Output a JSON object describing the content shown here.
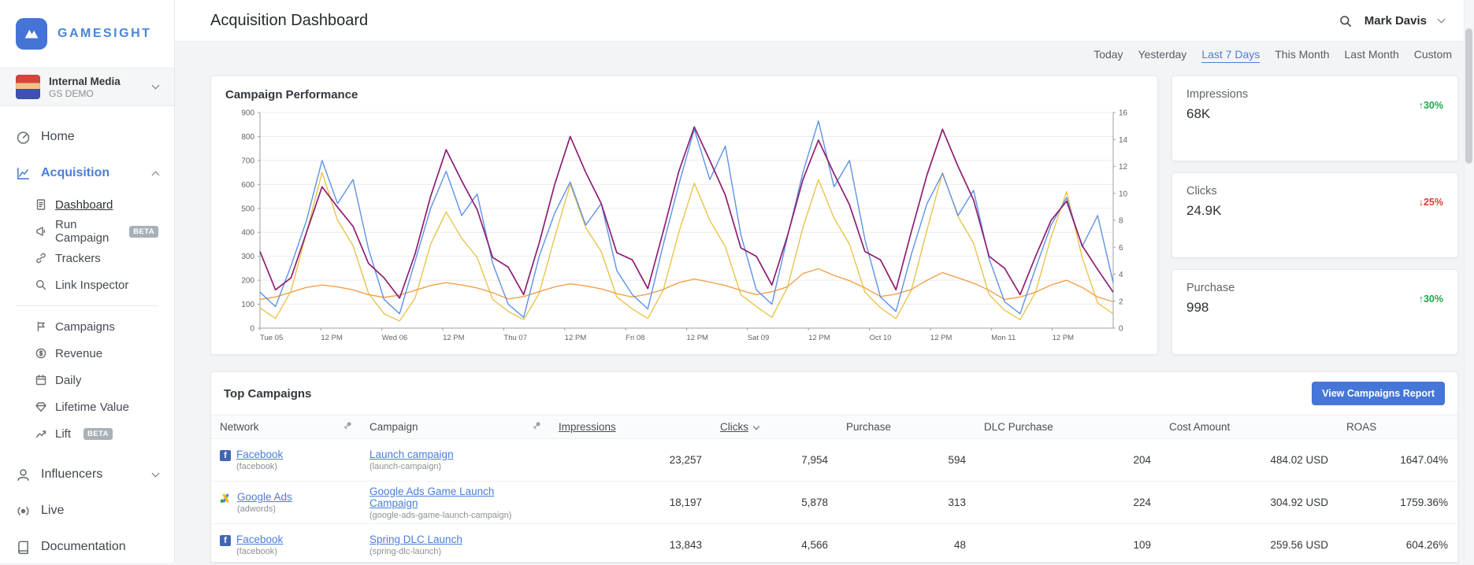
{
  "brand": {
    "name": "GAMESIGHT"
  },
  "account": {
    "name": "Internal Media",
    "org": "GS DEMO"
  },
  "header": {
    "title": "Acquisition Dashboard",
    "user": "Mark Davis"
  },
  "date_ranges": {
    "items": [
      "Today",
      "Yesterday",
      "Last 7 Days",
      "This Month",
      "Last Month",
      "Custom"
    ],
    "active": "Last 7 Days"
  },
  "sidebar": {
    "items": [
      {
        "label": "Home"
      },
      {
        "label": "Acquisition",
        "expanded": true,
        "children": [
          {
            "label": "Dashboard",
            "active": true
          },
          {
            "label": "Run Campaign",
            "badge": "BETA"
          },
          {
            "label": "Trackers"
          },
          {
            "label": "Link Inspector"
          },
          {
            "label": "Campaigns"
          },
          {
            "label": "Revenue"
          },
          {
            "label": "Daily"
          },
          {
            "label": "Lifetime Value"
          },
          {
            "label": "Lift",
            "badge": "BETA"
          }
        ]
      },
      {
        "label": "Influencers"
      },
      {
        "label": "Live"
      },
      {
        "label": "Documentation"
      }
    ]
  },
  "stats": [
    {
      "label": "Impressions",
      "value": "68K",
      "delta": "↑30%",
      "trend": "up"
    },
    {
      "label": "Clicks",
      "value": "24.9K",
      "delta": "↓25%",
      "trend": "down"
    },
    {
      "label": "Purchase",
      "value": "998",
      "delta": "↑30%",
      "trend": "up"
    }
  ],
  "chart_data": {
    "type": "line",
    "title": "Campaign Performance",
    "x_tick_labels": [
      "Tue 05",
      "12 PM",
      "Wed 06",
      "12 PM",
      "Thu 07",
      "12 PM",
      "Fri 08",
      "12 PM",
      "Sat 09",
      "12 PM",
      "Oct 10",
      "12 PM",
      "Mon 11",
      "12 PM"
    ],
    "y_left": {
      "min": 0,
      "max": 900,
      "step": 100
    },
    "y_right": {
      "min": 0,
      "max": 16,
      "step": 2
    },
    "grid": true,
    "legend": false,
    "series": [
      {
        "name": "series-1",
        "color": "#e8c44f",
        "values": [
          85,
          40,
          155,
          400,
          650,
          450,
          345,
          145,
          60,
          30,
          125,
          350,
          485,
          375,
          295,
          120,
          70,
          35,
          145,
          380,
          600,
          420,
          320,
          130,
          80,
          40,
          160,
          400,
          605,
          450,
          340,
          140,
          90,
          45,
          170,
          420,
          620,
          460,
          350,
          150,
          85,
          40,
          160,
          410,
          650,
          465,
          355,
          140,
          75,
          35,
          150,
          380,
          570,
          295,
          105,
          60
        ]
      },
      {
        "name": "series-2",
        "color": "#f4a04c",
        "values": [
          120,
          130,
          150,
          170,
          180,
          172,
          160,
          140,
          128,
          138,
          158,
          178,
          190,
          180,
          168,
          148,
          122,
          132,
          152,
          172,
          185,
          176,
          164,
          144,
          130,
          142,
          162,
          190,
          205,
          192,
          178,
          158,
          140,
          152,
          172,
          228,
          248,
          220,
          198,
          168,
          132,
          142,
          162,
          200,
          232,
          210,
          188,
          158,
          120,
          130,
          150,
          180,
          200,
          170,
          130,
          110
        ]
      },
      {
        "name": "series-3",
        "color": "#5e92e5",
        "values": [
          150,
          90,
          260,
          450,
          700,
          520,
          620,
          330,
          120,
          60,
          280,
          500,
          655,
          470,
          560,
          270,
          100,
          45,
          300,
          480,
          610,
          430,
          520,
          240,
          140,
          80,
          350,
          600,
          830,
          620,
          760,
          390,
          160,
          100,
          380,
          650,
          865,
          590,
          700,
          370,
          130,
          70,
          310,
          520,
          645,
          470,
          575,
          290,
          110,
          60,
          250,
          430,
          545,
          340,
          470,
          190
        ]
      },
      {
        "name": "series-4",
        "color": "#8e1e72",
        "values": [
          320,
          160,
          210,
          400,
          590,
          505,
          425,
          270,
          210,
          125,
          310,
          550,
          745,
          615,
          495,
          295,
          255,
          140,
          355,
          600,
          800,
          650,
          520,
          315,
          285,
          165,
          405,
          655,
          840,
          700,
          555,
          335,
          300,
          180,
          385,
          620,
          785,
          645,
          515,
          320,
          285,
          160,
          405,
          640,
          830,
          675,
          535,
          300,
          250,
          140,
          300,
          450,
          530,
          345,
          245,
          150
        ]
      }
    ]
  },
  "campaigns": {
    "title": "Top Campaigns",
    "report_button": "View Campaigns Report",
    "columns": [
      "Network",
      "Campaign",
      "Impressions",
      "Clicks",
      "Purchase",
      "DLC Purchase",
      "Cost Amount",
      "ROAS"
    ],
    "sorted_by": "Clicks",
    "rows": [
      {
        "network": "Facebook",
        "network_id": "(facebook)",
        "icon": "facebook-icon",
        "campaign": "Launch campaign",
        "campaign_id": "(launch-campaign)",
        "impressions": "23,257",
        "clicks": "7,954",
        "purchase": "594",
        "dlc_purchase": "204",
        "cost": "484.02 USD",
        "roas": "1647.04%"
      },
      {
        "network": "Google Ads",
        "network_id": "(adwords)",
        "icon": "google-ads-icon",
        "campaign": "Google Ads Game Launch Campaign",
        "campaign_id": "(google-ads-game-launch-campaign)",
        "impressions": "18,197",
        "clicks": "5,878",
        "purchase": "313",
        "dlc_purchase": "224",
        "cost": "304.92 USD",
        "roas": "1759.36%"
      },
      {
        "network": "Facebook",
        "network_id": "(facebook)",
        "icon": "facebook-icon",
        "campaign": "Spring DLC Launch",
        "campaign_id": "(spring-dlc-launch)",
        "impressions": "13,843",
        "clicks": "4,566",
        "purchase": "48",
        "dlc_purchase": "109",
        "cost": "259.56 USD",
        "roas": "604.26%"
      }
    ]
  },
  "icons": {
    "search": "magnifier",
    "pin": "pushpin",
    "sort_indicator": "chevron-down",
    "trend_up": "↑",
    "trend_down": "↓"
  },
  "colors": {
    "accent": "#4a7ed8",
    "positive": "#1fa64a",
    "negative": "#e23b30",
    "series": [
      "#e8c44f",
      "#f4a04c",
      "#5e92e5",
      "#8e1e72"
    ]
  }
}
